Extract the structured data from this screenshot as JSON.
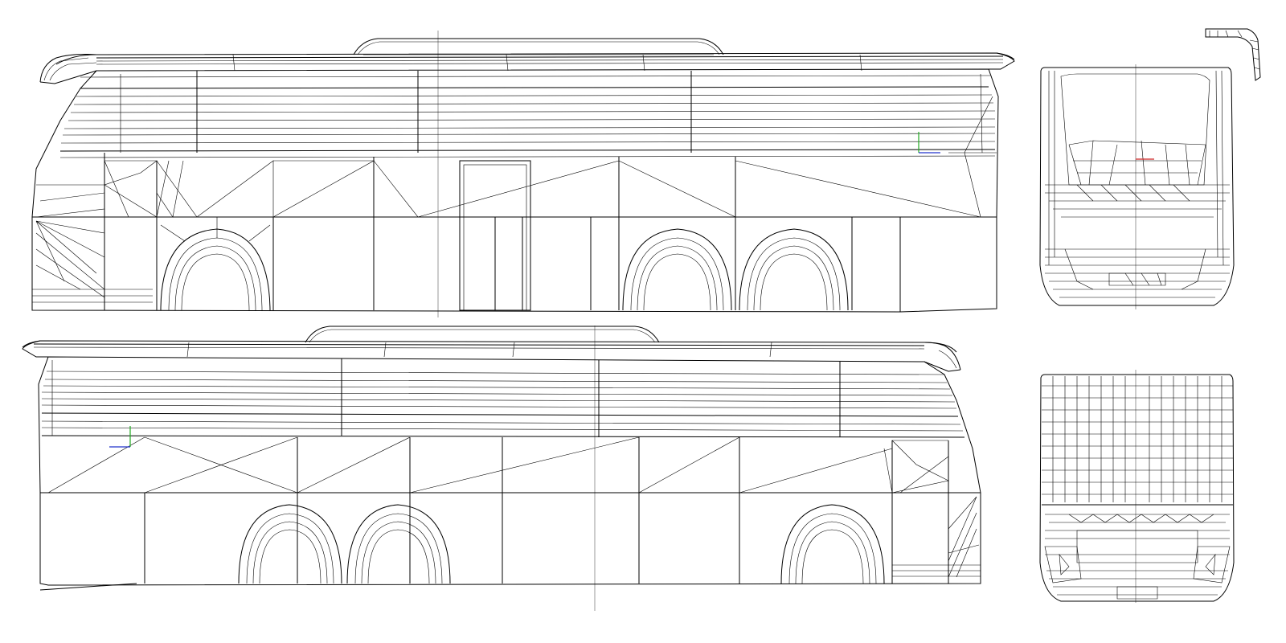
{
  "views": [
    {
      "id": "side-left",
      "label": ""
    },
    {
      "id": "side-right",
      "label": ""
    },
    {
      "id": "rear",
      "label": ""
    },
    {
      "id": "front",
      "label": ""
    },
    {
      "id": "mirror",
      "label": ""
    }
  ],
  "colors": {
    "wire": "#000000",
    "guide": "#9a9a9a",
    "axis_x": "#cc2222",
    "axis_y": "#22aa22",
    "axis_z": "#2233cc"
  }
}
